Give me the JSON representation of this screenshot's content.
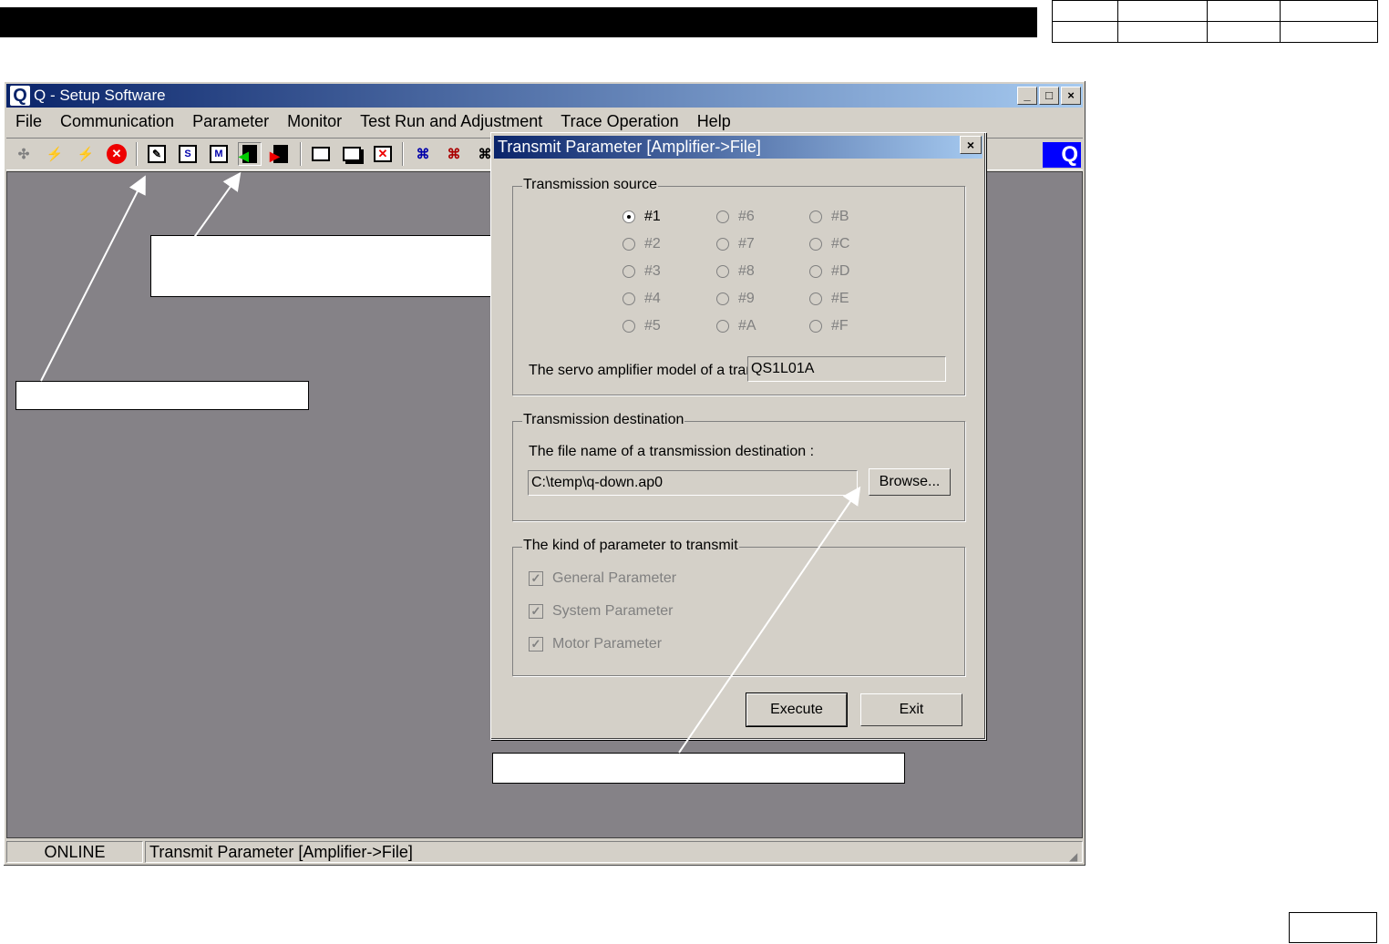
{
  "app": {
    "title": "Q - Setup Software",
    "logo_letter": "Q",
    "brand_letter": "Q",
    "window_buttons": [
      "_",
      "□",
      "×"
    ]
  },
  "menu": [
    "File",
    "Communication",
    "Parameter",
    "Monitor",
    "Test Run and Adjustment",
    "Trace Operation",
    "Help"
  ],
  "toolbar_icons": [
    "connect-icon",
    "disconnect-icon",
    "search-station-icon",
    "stop-icon",
    "edit-parameter-icon",
    "system-parameter-icon",
    "motor-parameter-icon",
    "transmit-amp-to-file-icon",
    "transmit-file-to-amp-icon",
    "monitor-icon",
    "multi-monitor-icon",
    "alarm-icon",
    "test-run-icon",
    "jog-icon",
    "trace-icon"
  ],
  "status": {
    "mode": "ONLINE",
    "message": "Transmit Parameter [Amplifier->File]"
  },
  "dialog": {
    "title": "Transmit Parameter [Amplifier->File]",
    "close": "×",
    "source_group": "Transmission source",
    "stations": [
      "#1",
      "#2",
      "#3",
      "#4",
      "#5",
      "#6",
      "#7",
      "#8",
      "#9",
      "#A",
      "#B",
      "#C",
      "#D",
      "#E",
      "#F"
    ],
    "selected_station": "#1",
    "model_label": "The servo amplifier model of a tran",
    "model_value": "QS1L01A",
    "dest_group": "Transmission destination",
    "file_label": "The file name of a transmission destination :",
    "file_value": "C:\\temp\\q-down.ap0",
    "browse": "Browse...",
    "kind_group": "The kind of parameter to transmit",
    "checks": [
      "General Parameter",
      "System Parameter",
      "Motor Parameter"
    ],
    "check_mark": "✓",
    "execute": "Execute",
    "exit": "Exit"
  }
}
